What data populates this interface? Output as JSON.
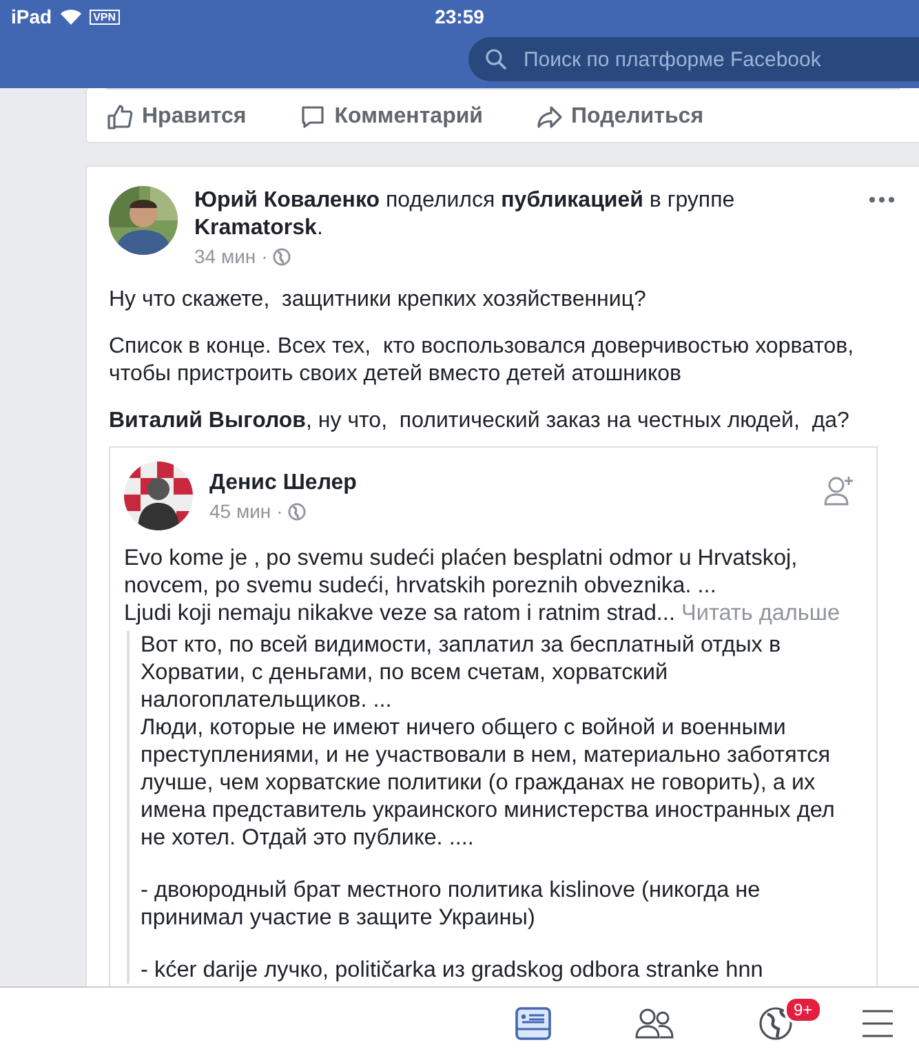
{
  "status_bar": {
    "device": "iPad",
    "vpn": "VPN",
    "time": "23:59"
  },
  "search": {
    "placeholder": "Поиск по платформе Facebook"
  },
  "previous_post": {
    "actions": [
      {
        "kind": "like",
        "label": "Нравится"
      },
      {
        "kind": "comment",
        "label": "Комментарий"
      },
      {
        "kind": "share",
        "label": "Поделиться"
      }
    ]
  },
  "post": {
    "header": "**Юрий Коваленко** поделился **публикацией** в группе **Kramatorsk**.",
    "time": "34 мин",
    "separator": "·",
    "paragraphs": [
      "Ну что скажете,  защитники крепких хозяйственниц?",
      "Список в конце. Всех тех,  кто воспользовался доверчивостью хорватов,  чтобы пристроить своих детей вместо детей атошников",
      "**Виталий Выголов**, ну что,  политический заказ на честных людей,  да?"
    ],
    "shared": {
      "author": "Денис Шелер",
      "time": "45 мин",
      "separator": "·",
      "text": "Evo kome je , po svemu sudeći plaćen besplatni odmor u Hrvatskoj,\nnovcem, po svemu sudeći, hrvatskih poreznih obveznika. ...\nLjudi koji nemaju nikakve veze sa ratom i ratnim strad...",
      "more": "Читать дальше",
      "translation": [
        "Вот кто, по всей видимости, заплатил за бесплатный отдых в Хорватии, с деньгами, по всем счетам, хорватский налогоплательщиков. ...\nЛюди, которые не имеют ничего общего с войной и военными преступлениями, и не участвовали в нем, материально заботятся лучше, чем хорватские политики (о гражданах не говорить), а их имена представитель украинского министерства иностранных дел не хотел. Отдай это публике. ....",
        "- двоюродный брат местного политика kislinove (никогда не принимал участие в защите Украины)",
        "- kćer darije лучко, političarka из gradskog odbora stranke hnn"
      ]
    }
  },
  "tab_bar": [
    {
      "kind": "feed",
      "selected": true
    },
    {
      "kind": "friends",
      "selected": false
    },
    {
      "kind": "globe",
      "selected": false,
      "badge": "9+"
    },
    {
      "kind": "menu",
      "selected": false
    }
  ]
}
